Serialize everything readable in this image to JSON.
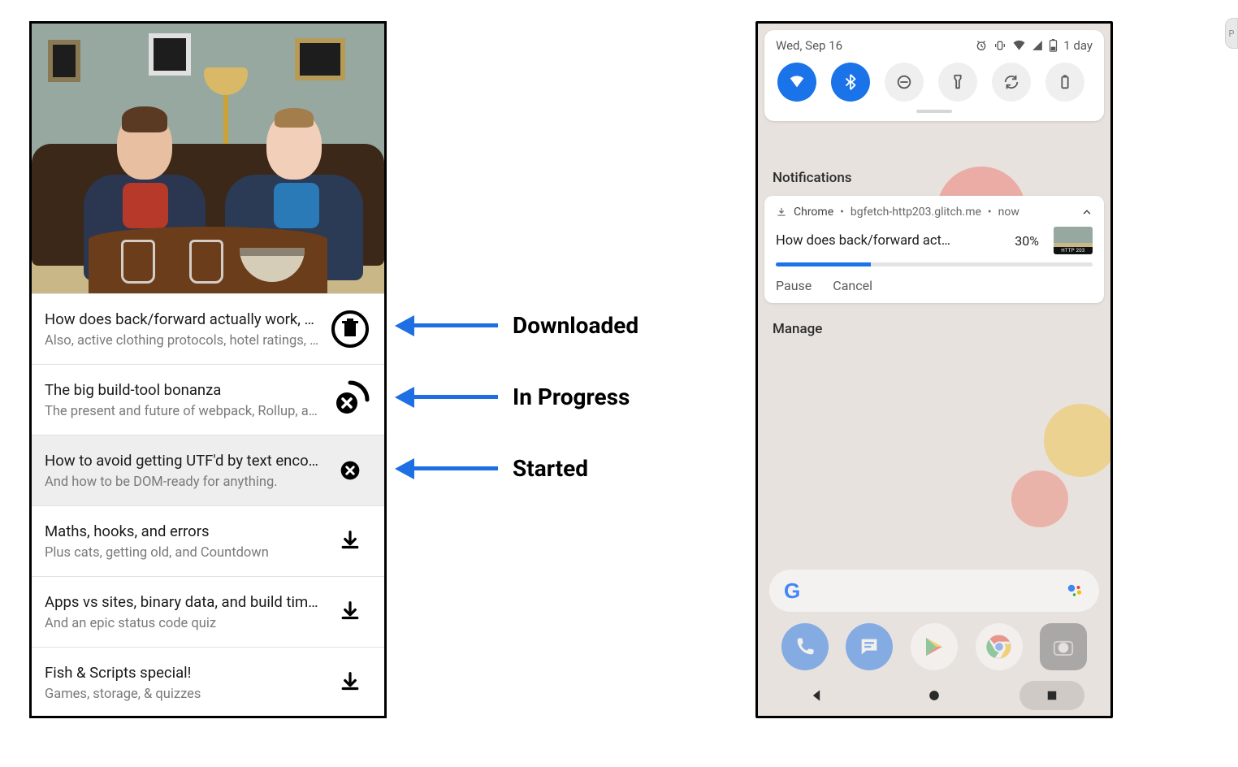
{
  "left": {
    "items": [
      {
        "title": "How does back/forward actually work, an…",
        "subtitle": "Also, active clothing protocols, hotel ratings, a…",
        "icon": "trash"
      },
      {
        "title": "The big build-tool bonanza",
        "subtitle": "The present and future of webpack, Rollup, an…",
        "icon": "progress"
      },
      {
        "title": "How to avoid getting UTF'd by text encodi…",
        "subtitle": "And how to be DOM-ready for anything.",
        "icon": "cancel",
        "selected": true
      },
      {
        "title": "Maths, hooks, and errors",
        "subtitle": "Plus cats, getting old, and Countdown",
        "icon": "download"
      },
      {
        "title": "Apps vs sites, binary data, and build times",
        "subtitle": "And an epic status code quiz",
        "icon": "download"
      },
      {
        "title": "Fish & Scripts special!",
        "subtitle": "Games, storage, & quizzes",
        "icon": "download"
      }
    ]
  },
  "annotations": [
    {
      "label": "Downloaded"
    },
    {
      "label": "In Progress"
    },
    {
      "label": "Started"
    }
  ],
  "right": {
    "status_date": "Wed, Sep 16",
    "status_battery": "1 day",
    "notifications_header": "Notifications",
    "notif": {
      "app": "Chrome",
      "source": "bgfetch-http203.glitch.me",
      "time": "now",
      "title": "How does back/forward act…",
      "percent": "30%",
      "progress": 30,
      "thumb_label": "HTTP 203",
      "actions": {
        "pause": "Pause",
        "cancel": "Cancel"
      }
    },
    "manage": "Manage"
  },
  "pill": "P"
}
